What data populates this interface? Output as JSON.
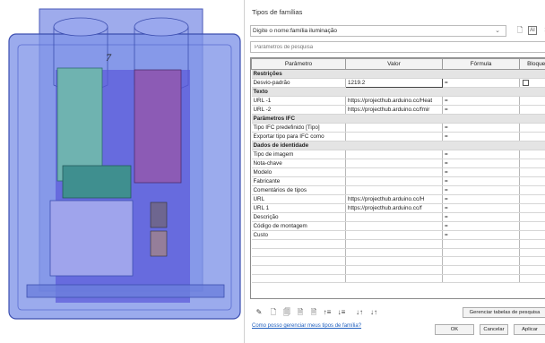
{
  "dialog": {
    "title": "Tipos de famílias",
    "type_name_label": "Digite o nome:",
    "type_name_value": "família iluminação",
    "search_placeholder": "Parâmetros de pesquisa",
    "columns": [
      "Parâmetro",
      "Valor",
      "Fórmula",
      "Bloqueo"
    ],
    "rows": [
      {
        "kind": "group",
        "label": "Restrições"
      },
      {
        "kind": "param",
        "label": "Desvio-padrão",
        "value": "1219.2",
        "formula": "=",
        "lock": true
      },
      {
        "kind": "group",
        "label": "Texto"
      },
      {
        "kind": "param",
        "label": "URL -1",
        "value": "https://projecthub.arduino.cc/Heat",
        "formula": "="
      },
      {
        "kind": "param",
        "label": "URL -2",
        "value": "https://projecthub.arduino.cc/fmir",
        "formula": "="
      },
      {
        "kind": "group",
        "label": "Parâmetros IFC"
      },
      {
        "kind": "param",
        "label": "Tipo IFC predefinido [Tipo]",
        "value": "",
        "formula": "="
      },
      {
        "kind": "param",
        "label": "Exportar tipo para IFC como",
        "value": "",
        "formula": "="
      },
      {
        "kind": "group",
        "label": "Dados de identidade"
      },
      {
        "kind": "param",
        "label": "Tipo de imagem",
        "value": "",
        "formula": "="
      },
      {
        "kind": "param",
        "label": "Nota-chave",
        "value": "",
        "formula": "="
      },
      {
        "kind": "param",
        "label": "Modelo",
        "value": "",
        "formula": "="
      },
      {
        "kind": "param",
        "label": "Fabricante",
        "value": "",
        "formula": "="
      },
      {
        "kind": "param",
        "label": "Comentários de tipos",
        "value": "",
        "formula": "="
      },
      {
        "kind": "param",
        "label": "URL",
        "value": "https://projecthub.arduino.cc/H",
        "formula": "="
      },
      {
        "kind": "param",
        "label": "URL 1",
        "value": "https://projecthub.arduino.cc/f",
        "formula": "="
      },
      {
        "kind": "param",
        "label": "Descrição",
        "value": "",
        "formula": "="
      },
      {
        "kind": "param",
        "label": "Código de montagem",
        "value": "",
        "formula": "="
      },
      {
        "kind": "param",
        "label": "Custo",
        "value": "",
        "formula": "="
      },
      {
        "kind": "empty"
      },
      {
        "kind": "empty"
      },
      {
        "kind": "empty"
      },
      {
        "kind": "empty"
      },
      {
        "kind": "empty"
      }
    ],
    "manage_lookup_label": "Gerenciar tabelas de pesquisa",
    "help_link": "Como posso gerenciar meus tipos de família?",
    "ok_label": "OK",
    "cancel_label": "Cancelar",
    "apply_label": "Aplicar"
  },
  "viewport": {
    "annotation": "7"
  },
  "icons": {
    "type_toolbar": [
      "new-type-icon",
      "rename-type-icon",
      "delete-type-icon"
    ],
    "param_toolbar": [
      "edit-parameter-icon",
      "new-parameter-icon",
      "delete-parameter-icon",
      "move-up-icon",
      "move-down-icon",
      "sort-ascending-icon",
      "sort-descending-icon",
      "sort-az-icon",
      "sort-za-icon"
    ]
  }
}
